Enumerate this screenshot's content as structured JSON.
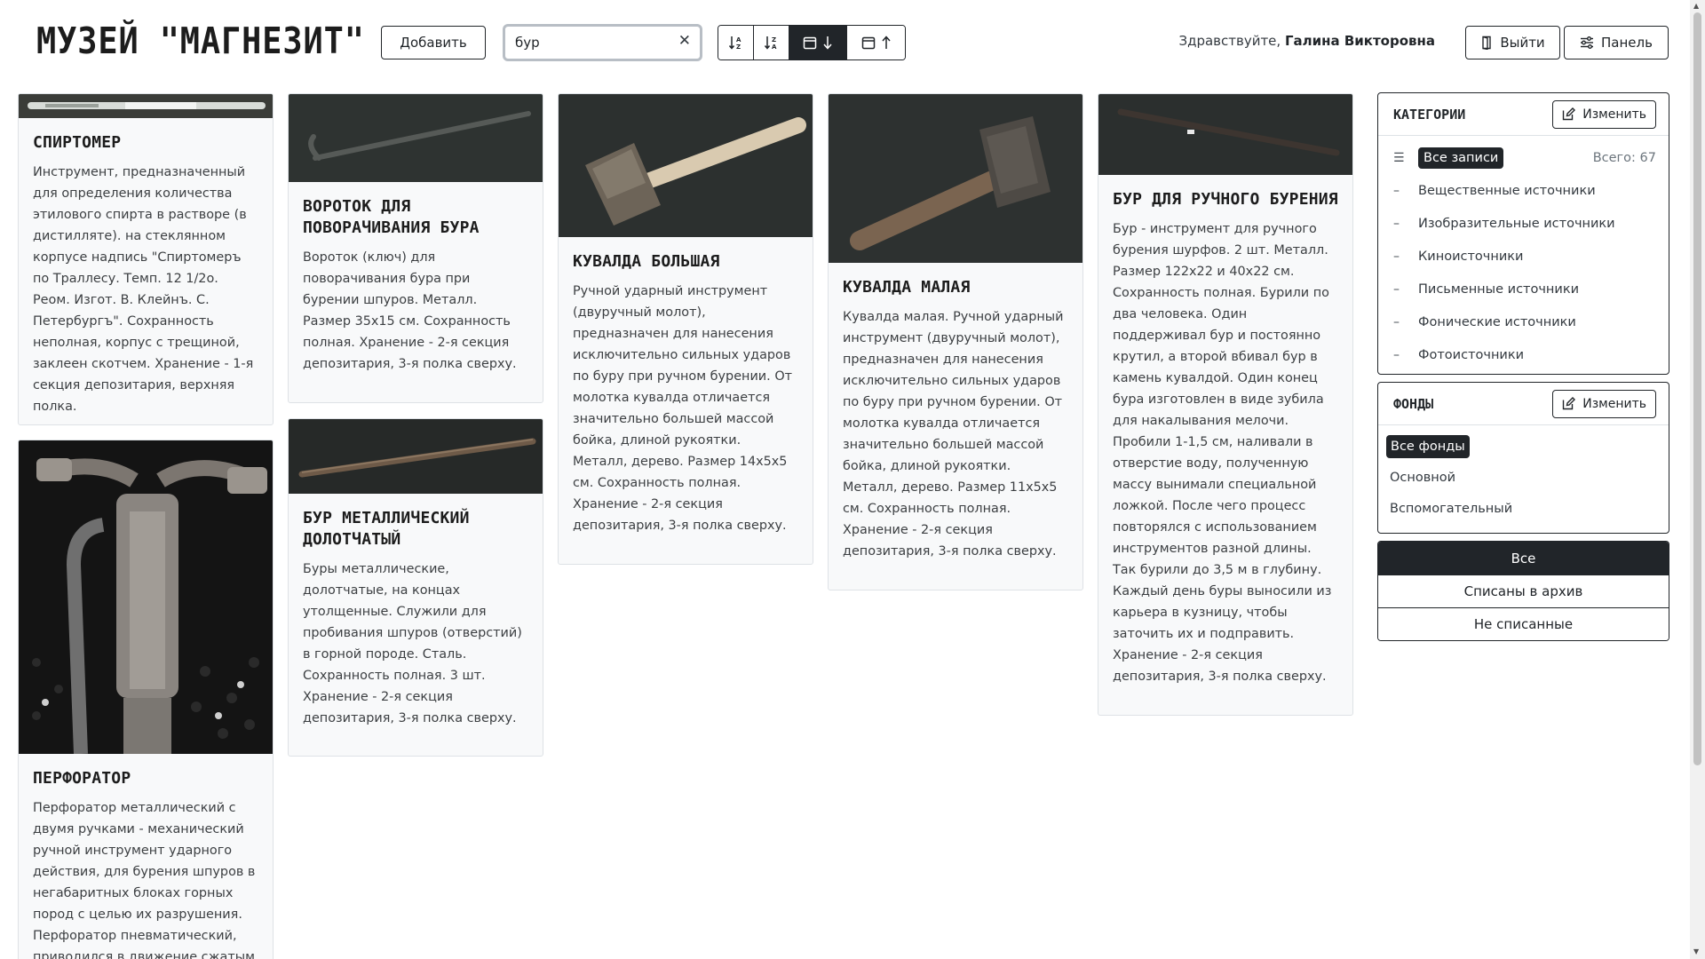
{
  "header": {
    "logo": "МУЗЕЙ \"МАГНЕЗИТ\"",
    "add_label": "Добавить",
    "search_value": "бур",
    "greeting_prefix": "Здравствуйте,",
    "user_name": "Галина Викторовна",
    "logout_label": "Выйти",
    "panel_label": "Панель",
    "sort_buttons": [
      {
        "icon": "sort-alpha-asc-icon",
        "active": false
      },
      {
        "icon": "sort-alpha-desc-icon",
        "active": false
      },
      {
        "icon": "calendar-sort-desc-icon",
        "active": true
      },
      {
        "icon": "calendar-sort-asc-icon",
        "active": false
      }
    ]
  },
  "cards": [
    {
      "title": "СПИРТОМЕР",
      "text": "Инструмент, предназначенный для определения количества этилового спирта в растворе (в дистилляте). на стеклянном корпусе надпись \"Спиртомеръ по Траллесу. Темп. 12 1/2о. Реом. Изгот. В. Клейнъ. С. Петербургъ\". Сохранность неполная, корпус с трещиной, заклеен скотчем. Хранение - 1-я секция депозитария, верхняя полка."
    },
    {
      "title": "ПЕРФОРАТОР",
      "text": "Перфоратор металлический с двумя ручками - механический ручной инструмент ударного действия, для бурения шпуров в негабаритных блоках горных пород с целью их разрушения. Перфоратор пневматический, приводился в движение сжатым"
    },
    {
      "title": "ВОРОТОК ДЛЯ ПОВОРАЧИВАНИЯ БУРА",
      "text": "Вороток (ключ) для поворачивания бура при бурении шпуров. Металл. Размер 35х15 см. Сохранность полная. Хранение - 2-я секция депозитария, 3-я полка сверху."
    },
    {
      "title": "БУР МЕТАЛЛИЧЕСКИЙ ДОЛОТЧАТЫЙ",
      "text": "Буры металлические, долотчатые, на концах утолщенные. Служили для пробивания шпуров (отверстий) в горной породе. Сталь. Сохранность полная. 3 шт. Хранение - 2-я секция депозитария, 3-я полка сверху."
    },
    {
      "title": "КУВАЛДА БОЛЬШАЯ",
      "text": "Ручной ударный инструмент (двуручный молот), предназначен для нанесения исключительно сильных ударов по буру при ручном бурении. От молотка кувалда отличается значительно большей массой бойка, длиной рукоятки. Металл, дерево. Размер 14х5х5 см. Сохранность полная. Хранение - 2-я секция депозитария, 3-я полка сверху."
    },
    {
      "title": "КУВАЛДА МАЛАЯ",
      "text": "Кувалда малая. Ручной ударный инструмент (двуручный молот), предназначен для нанесения исключительно сильных ударов по буру при ручном бурении. От молотка кувалда отличается значительно большей массой бойка, длиной рукоятки. Металл, дерево. Размер 11х5х5 см. Сохранность полная. Хранение - 2-я секция депозитария, 3-я полка сверху."
    },
    {
      "title": "БУР ДЛЯ РУЧНОГО БУРЕНИЯ",
      "text": "Бур - инструмент для ручного бурения шурфов. 2 шт. Металл. Размер 122х22 и 40х22 см. Сохранность полная. Бурили по два человека. Один поддерживал бур и постоянно крутил, а второй вбивал бур в камень кувалдой. Один конец бура изготовлен в виде зубила для накалывания мелочи. Пробили 1-1,5 см, наливали в отверстие воду, полученную массу вынимали специальной ложкой. После чего процесс повторялся с использованием инструментов разной длины. Так бурили до 3,5 м в глубину. Каждый день буры выносили из карьера в кузницу, чтобы заточить их и подправить. Хранение - 2-я секция депозитария, 3-я полка сверху."
    }
  ],
  "categories": {
    "title": "КАТЕГОРИИ",
    "edit_label": "Изменить",
    "all_label": "Все записи",
    "total_label": "Всего: 67",
    "items": [
      "Вещественные источники",
      "Изобразительные источники",
      "Киноисточники",
      "Письменные источники",
      "Фонические источники",
      "Фотоисточники"
    ]
  },
  "funds": {
    "title": "ФОНДЫ",
    "edit_label": "Изменить",
    "all_label": "Все фонды",
    "items": [
      "Основной",
      "Вспомогательный"
    ]
  },
  "archive_filter": {
    "options": [
      "Все",
      "Списаны в архив",
      "Не списанные"
    ],
    "selected": "Все"
  }
}
